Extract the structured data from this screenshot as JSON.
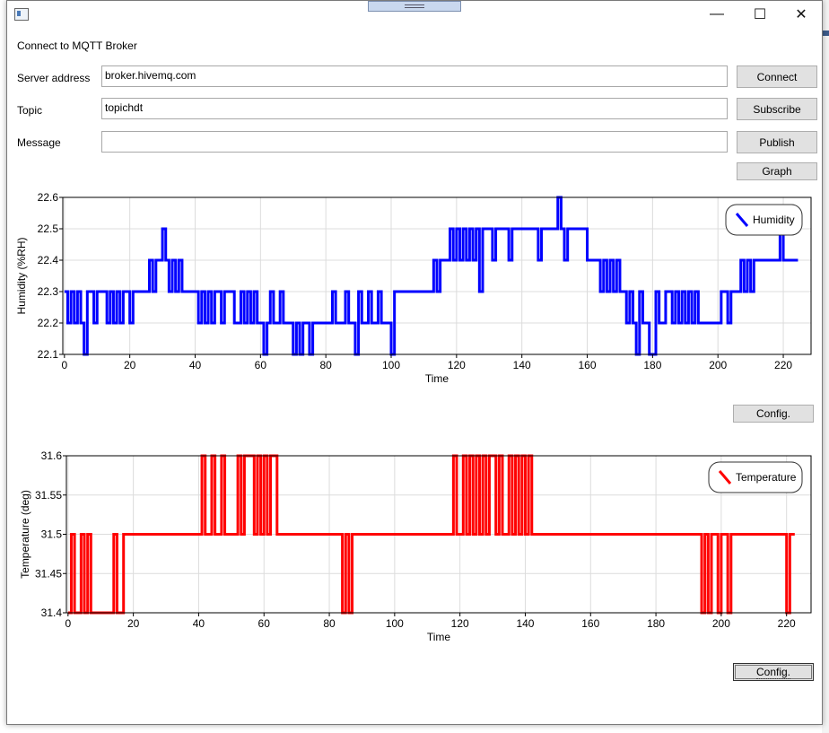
{
  "window": {
    "icon": "app-window-icon",
    "minimize_glyph": "—",
    "maximize_glyph": "☐",
    "close_glyph": "✕"
  },
  "form": {
    "heading": "Connect to MQTT Broker",
    "server_label": "Server address",
    "server_value": "broker.hivemq.com",
    "topic_label": "Topic",
    "topic_value": "topichdt",
    "message_label": "Message",
    "message_value": "",
    "connect_label": "Connect",
    "subscribe_label": "Subscribe",
    "publish_label": "Publish",
    "graph_label": "Graph",
    "config1_label": "Config.",
    "config2_label": "Config."
  },
  "chart_data": [
    {
      "type": "line",
      "title": "",
      "xlabel": "Time",
      "ylabel": "Humidity (%RH)",
      "xlim": [
        -0.5,
        228.5
      ],
      "ylim": [
        22.1,
        22.6
      ],
      "xticks": [
        0,
        20,
        40,
        60,
        80,
        100,
        120,
        140,
        160,
        180,
        200,
        220
      ],
      "yticks": [
        22.1,
        22.2,
        22.3,
        22.4,
        22.5,
        22.6
      ],
      "ytick_labels": [
        "22.1",
        "22.2",
        "22.3",
        "22.4",
        "22.5",
        "22.6"
      ],
      "grid": true,
      "legend_position": "top-right",
      "series": [
        {
          "name": "Humidity",
          "color": "#0000ff",
          "step": true,
          "y": [
            22.3,
            22.2,
            22.3,
            22.2,
            22.3,
            22.2,
            22.1,
            22.3,
            22.3,
            22.2,
            22.3,
            22.3,
            22.3,
            22.2,
            22.3,
            22.2,
            22.3,
            22.2,
            22.3,
            22.3,
            22.2,
            22.3,
            22.3,
            22.3,
            22.3,
            22.3,
            22.4,
            22.3,
            22.4,
            22.4,
            22.5,
            22.4,
            22.3,
            22.4,
            22.3,
            22.4,
            22.3,
            22.3,
            22.3,
            22.3,
            22.3,
            22.2,
            22.3,
            22.2,
            22.3,
            22.2,
            22.3,
            22.3,
            22.2,
            22.3,
            22.3,
            22.3,
            22.2,
            22.2,
            22.3,
            22.2,
            22.3,
            22.2,
            22.3,
            22.2,
            22.2,
            22.1,
            22.2,
            22.3,
            22.2,
            22.2,
            22.3,
            22.2,
            22.2,
            22.2,
            22.1,
            22.2,
            22.1,
            22.2,
            22.2,
            22.1,
            22.2,
            22.2,
            22.2,
            22.2,
            22.2,
            22.2,
            22.3,
            22.2,
            22.2,
            22.2,
            22.3,
            22.2,
            22.2,
            22.1,
            22.3,
            22.2,
            22.2,
            22.3,
            22.2,
            22.2,
            22.3,
            22.2,
            22.2,
            22.2,
            22.1,
            22.3,
            22.3,
            22.3,
            22.3,
            22.3,
            22.3,
            22.3,
            22.3,
            22.3,
            22.3,
            22.3,
            22.3,
            22.4,
            22.3,
            22.4,
            22.4,
            22.4,
            22.5,
            22.4,
            22.5,
            22.4,
            22.5,
            22.4,
            22.5,
            22.4,
            22.5,
            22.3,
            22.5,
            22.5,
            22.5,
            22.4,
            22.5,
            22.5,
            22.5,
            22.5,
            22.4,
            22.5,
            22.5,
            22.5,
            22.5,
            22.5,
            22.5,
            22.5,
            22.5,
            22.4,
            22.5,
            22.5,
            22.5,
            22.5,
            22.5,
            22.6,
            22.5,
            22.4,
            22.5,
            22.5,
            22.5,
            22.5,
            22.5,
            22.5,
            22.4,
            22.4,
            22.4,
            22.4,
            22.3,
            22.4,
            22.3,
            22.4,
            22.3,
            22.4,
            22.3,
            22.3,
            22.2,
            22.3,
            22.2,
            22.1,
            22.3,
            22.2,
            22.2,
            22.1,
            22.1,
            22.3,
            22.2,
            22.2,
            22.3,
            22.3,
            22.2,
            22.3,
            22.2,
            22.3,
            22.2,
            22.3,
            22.2,
            22.3,
            22.2,
            22.2,
            22.2,
            22.2,
            22.2,
            22.2,
            22.2,
            22.3,
            22.3,
            22.2,
            22.3,
            22.3,
            22.3,
            22.4,
            22.3,
            22.4,
            22.3,
            22.4,
            22.4,
            22.4,
            22.4,
            22.4,
            22.4,
            22.4,
            22.4,
            22.5,
            22.4,
            22.4,
            22.4,
            22.4,
            22.4
          ]
        }
      ]
    },
    {
      "type": "line",
      "title": "",
      "xlabel": "Time",
      "ylabel": "Temperature (deg)",
      "xlim": [
        -0.5,
        227.5
      ],
      "ylim": [
        31.4,
        31.6
      ],
      "xticks": [
        0,
        20,
        40,
        60,
        80,
        100,
        120,
        140,
        160,
        180,
        200,
        220
      ],
      "yticks": [
        31.4,
        31.45,
        31.5,
        31.55,
        31.6
      ],
      "ytick_labels": [
        "31.4",
        "31.45",
        "31.5",
        "31.55",
        "31.6"
      ],
      "grid": true,
      "legend_position": "top-right",
      "series": [
        {
          "name": "Temperature",
          "color": "#ff0000",
          "step": true,
          "y": [
            31.4,
            31.5,
            31.4,
            31.4,
            31.5,
            31.4,
            31.5,
            31.4,
            31.4,
            31.4,
            31.4,
            31.4,
            31.4,
            31.4,
            31.5,
            31.4,
            31.4,
            31.5,
            31.5,
            31.5,
            31.5,
            31.5,
            31.5,
            31.5,
            31.5,
            31.5,
            31.5,
            31.5,
            31.5,
            31.5,
            31.5,
            31.5,
            31.5,
            31.5,
            31.5,
            31.5,
            31.5,
            31.5,
            31.5,
            31.5,
            31.5,
            31.6,
            31.5,
            31.5,
            31.6,
            31.5,
            31.5,
            31.6,
            31.5,
            31.5,
            31.5,
            31.5,
            31.6,
            31.5,
            31.6,
            31.6,
            31.6,
            31.5,
            31.6,
            31.5,
            31.6,
            31.5,
            31.6,
            31.6,
            31.5,
            31.5,
            31.5,
            31.5,
            31.5,
            31.5,
            31.5,
            31.5,
            31.5,
            31.5,
            31.5,
            31.5,
            31.5,
            31.5,
            31.5,
            31.5,
            31.5,
            31.5,
            31.5,
            31.5,
            31.4,
            31.5,
            31.4,
            31.5,
            31.5,
            31.5,
            31.5,
            31.5,
            31.5,
            31.5,
            31.5,
            31.5,
            31.5,
            31.5,
            31.5,
            31.5,
            31.5,
            31.5,
            31.5,
            31.5,
            31.5,
            31.5,
            31.5,
            31.5,
            31.5,
            31.5,
            31.5,
            31.5,
            31.5,
            31.5,
            31.5,
            31.5,
            31.5,
            31.5,
            31.6,
            31.5,
            31.5,
            31.6,
            31.5,
            31.6,
            31.5,
            31.6,
            31.5,
            31.6,
            31.5,
            31.6,
            31.6,
            31.5,
            31.6,
            31.5,
            31.5,
            31.6,
            31.5,
            31.6,
            31.5,
            31.6,
            31.5,
            31.6,
            31.5,
            31.5,
            31.5,
            31.5,
            31.5,
            31.5,
            31.5,
            31.5,
            31.5,
            31.5,
            31.5,
            31.5,
            31.5,
            31.5,
            31.5,
            31.5,
            31.5,
            31.5,
            31.5,
            31.5,
            31.5,
            31.5,
            31.5,
            31.5,
            31.5,
            31.5,
            31.5,
            31.5,
            31.5,
            31.5,
            31.5,
            31.5,
            31.5,
            31.5,
            31.5,
            31.5,
            31.5,
            31.5,
            31.5,
            31.5,
            31.5,
            31.5,
            31.5,
            31.5,
            31.5,
            31.5,
            31.5,
            31.5,
            31.5,
            31.5,
            31.5,
            31.5,
            31.4,
            31.5,
            31.4,
            31.5,
            31.5,
            31.4,
            31.5,
            31.5,
            31.4,
            31.5,
            31.5,
            31.5,
            31.5,
            31.5,
            31.5,
            31.5,
            31.5,
            31.5,
            31.5,
            31.5,
            31.5,
            31.5,
            31.5,
            31.5,
            31.5,
            31.5,
            31.4,
            31.5,
            31.5
          ]
        }
      ]
    }
  ]
}
